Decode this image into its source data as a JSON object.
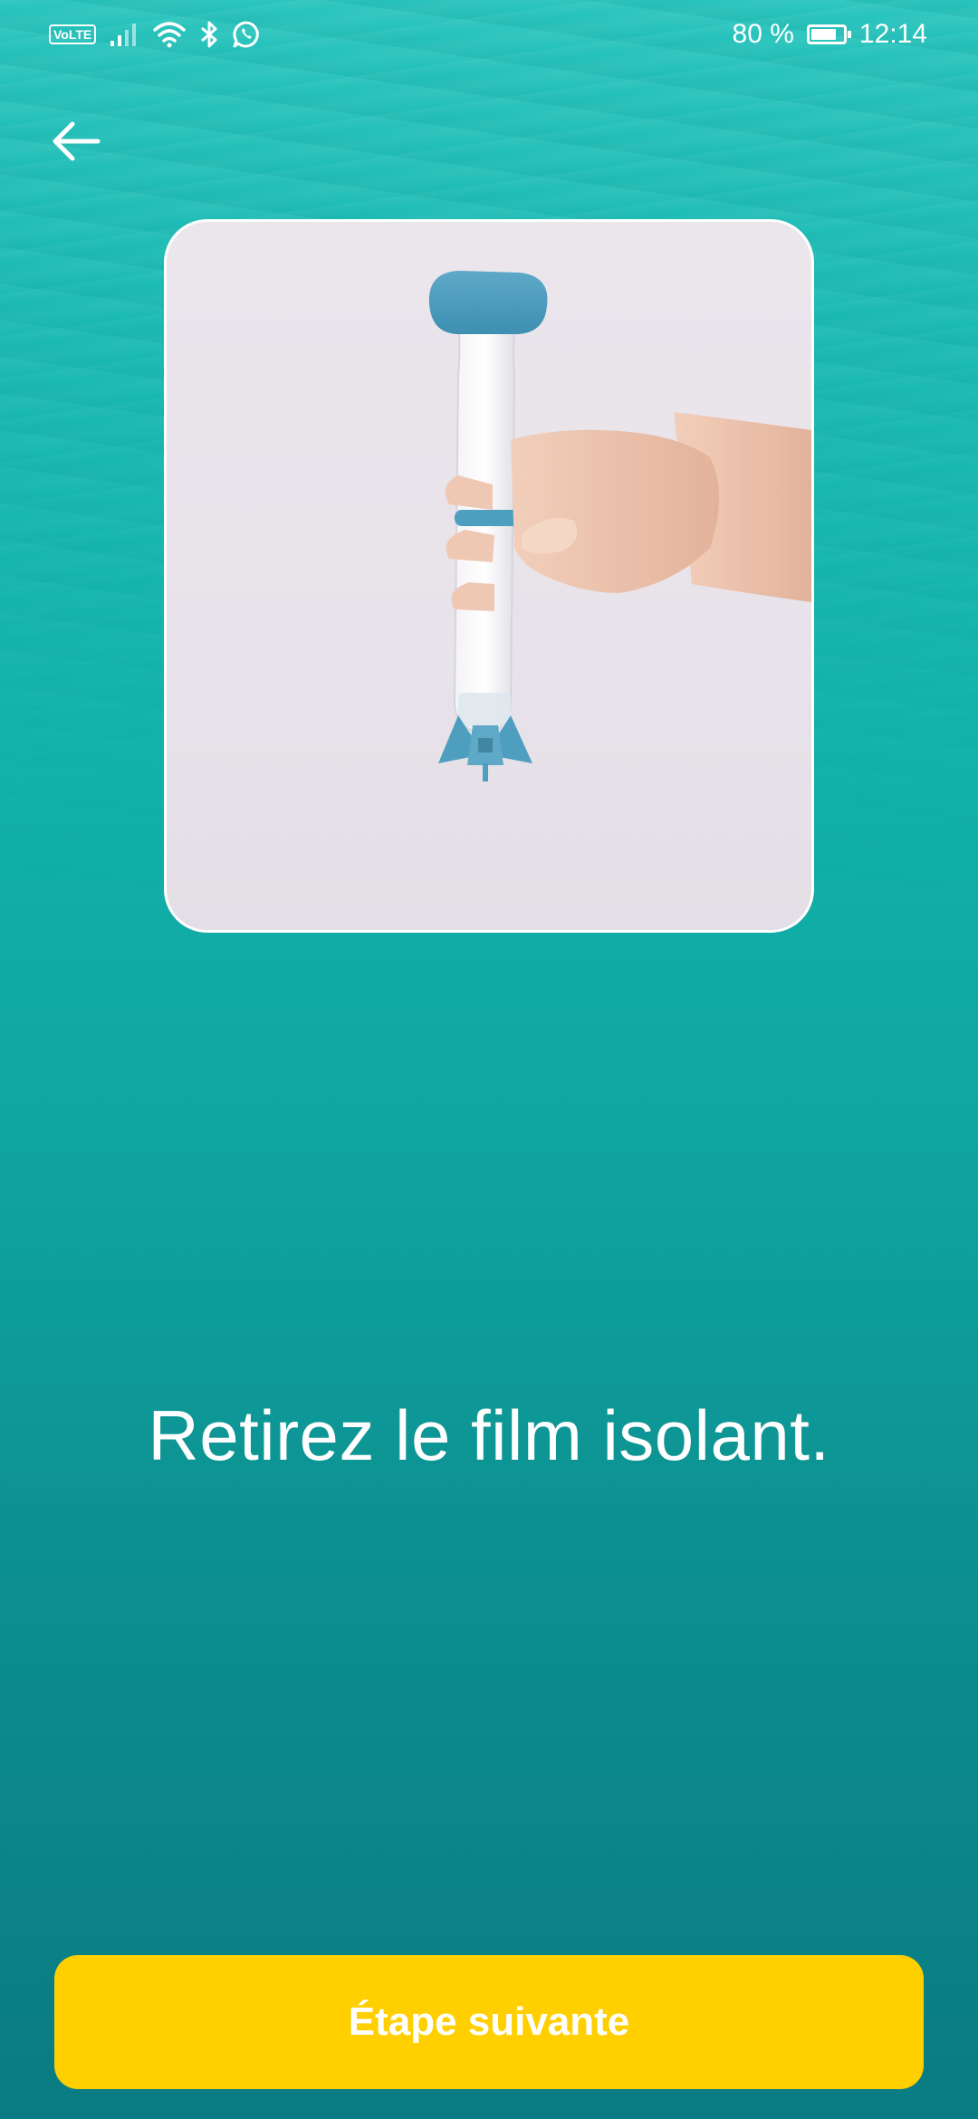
{
  "status_bar": {
    "network_badge": "VoLTE",
    "battery_text": "80 %",
    "battery_level": 0.8,
    "time": "12:14",
    "icons": [
      "volte-icon",
      "signal-icon",
      "wifi-icon",
      "bluetooth-icon",
      "whatsapp-icon",
      "battery-icon"
    ]
  },
  "header": {
    "back_icon": "arrow-left-icon"
  },
  "main": {
    "image_subject": "product-photo",
    "instruction": "Retirez le film isolant."
  },
  "footer": {
    "next_label": "Étape suivante"
  },
  "colors": {
    "accent": "#ffcf00",
    "background_top": "#27c4bd",
    "background_bottom": "#0a7b82",
    "product_blue": "#4e9fbf"
  }
}
